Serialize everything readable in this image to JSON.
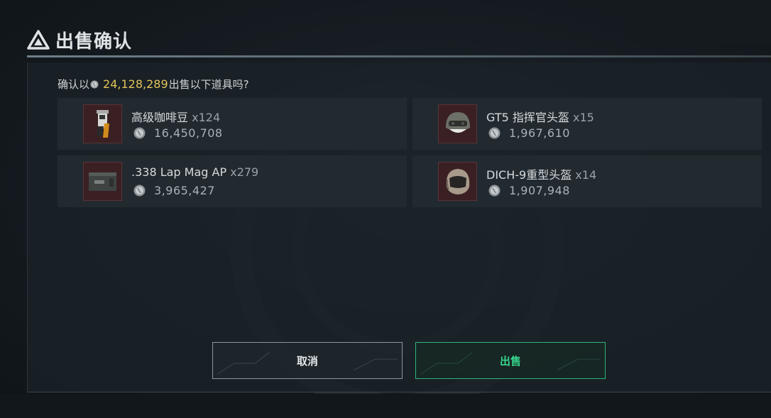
{
  "header": {
    "title": "出售确认"
  },
  "prompt": {
    "prefix": "确认以",
    "total": "24,128,289",
    "suffix": "出售以下道具吗?"
  },
  "items": [
    {
      "name": "高级咖啡豆",
      "qty": "x124",
      "price": "16,450,708",
      "icon": "coffee-beans-icon"
    },
    {
      "name": "GT5 指挥官头盔",
      "qty": "x15",
      "price": "1,967,610",
      "icon": "helmet-icon"
    },
    {
      "name": ".338 Lap Mag AP",
      "qty": "x279",
      "price": "3,965,427",
      "icon": "ammo-box-icon"
    },
    {
      "name": "DICH-9重型头盔",
      "qty": "x14",
      "price": "1,907,948",
      "icon": "heavy-helmet-icon"
    }
  ],
  "buttons": {
    "cancel": "取消",
    "sell": "出售"
  },
  "colors": {
    "amount": "#e2c35a",
    "sell_accent": "#38d48d",
    "thumb_bg": "#3a2023"
  }
}
